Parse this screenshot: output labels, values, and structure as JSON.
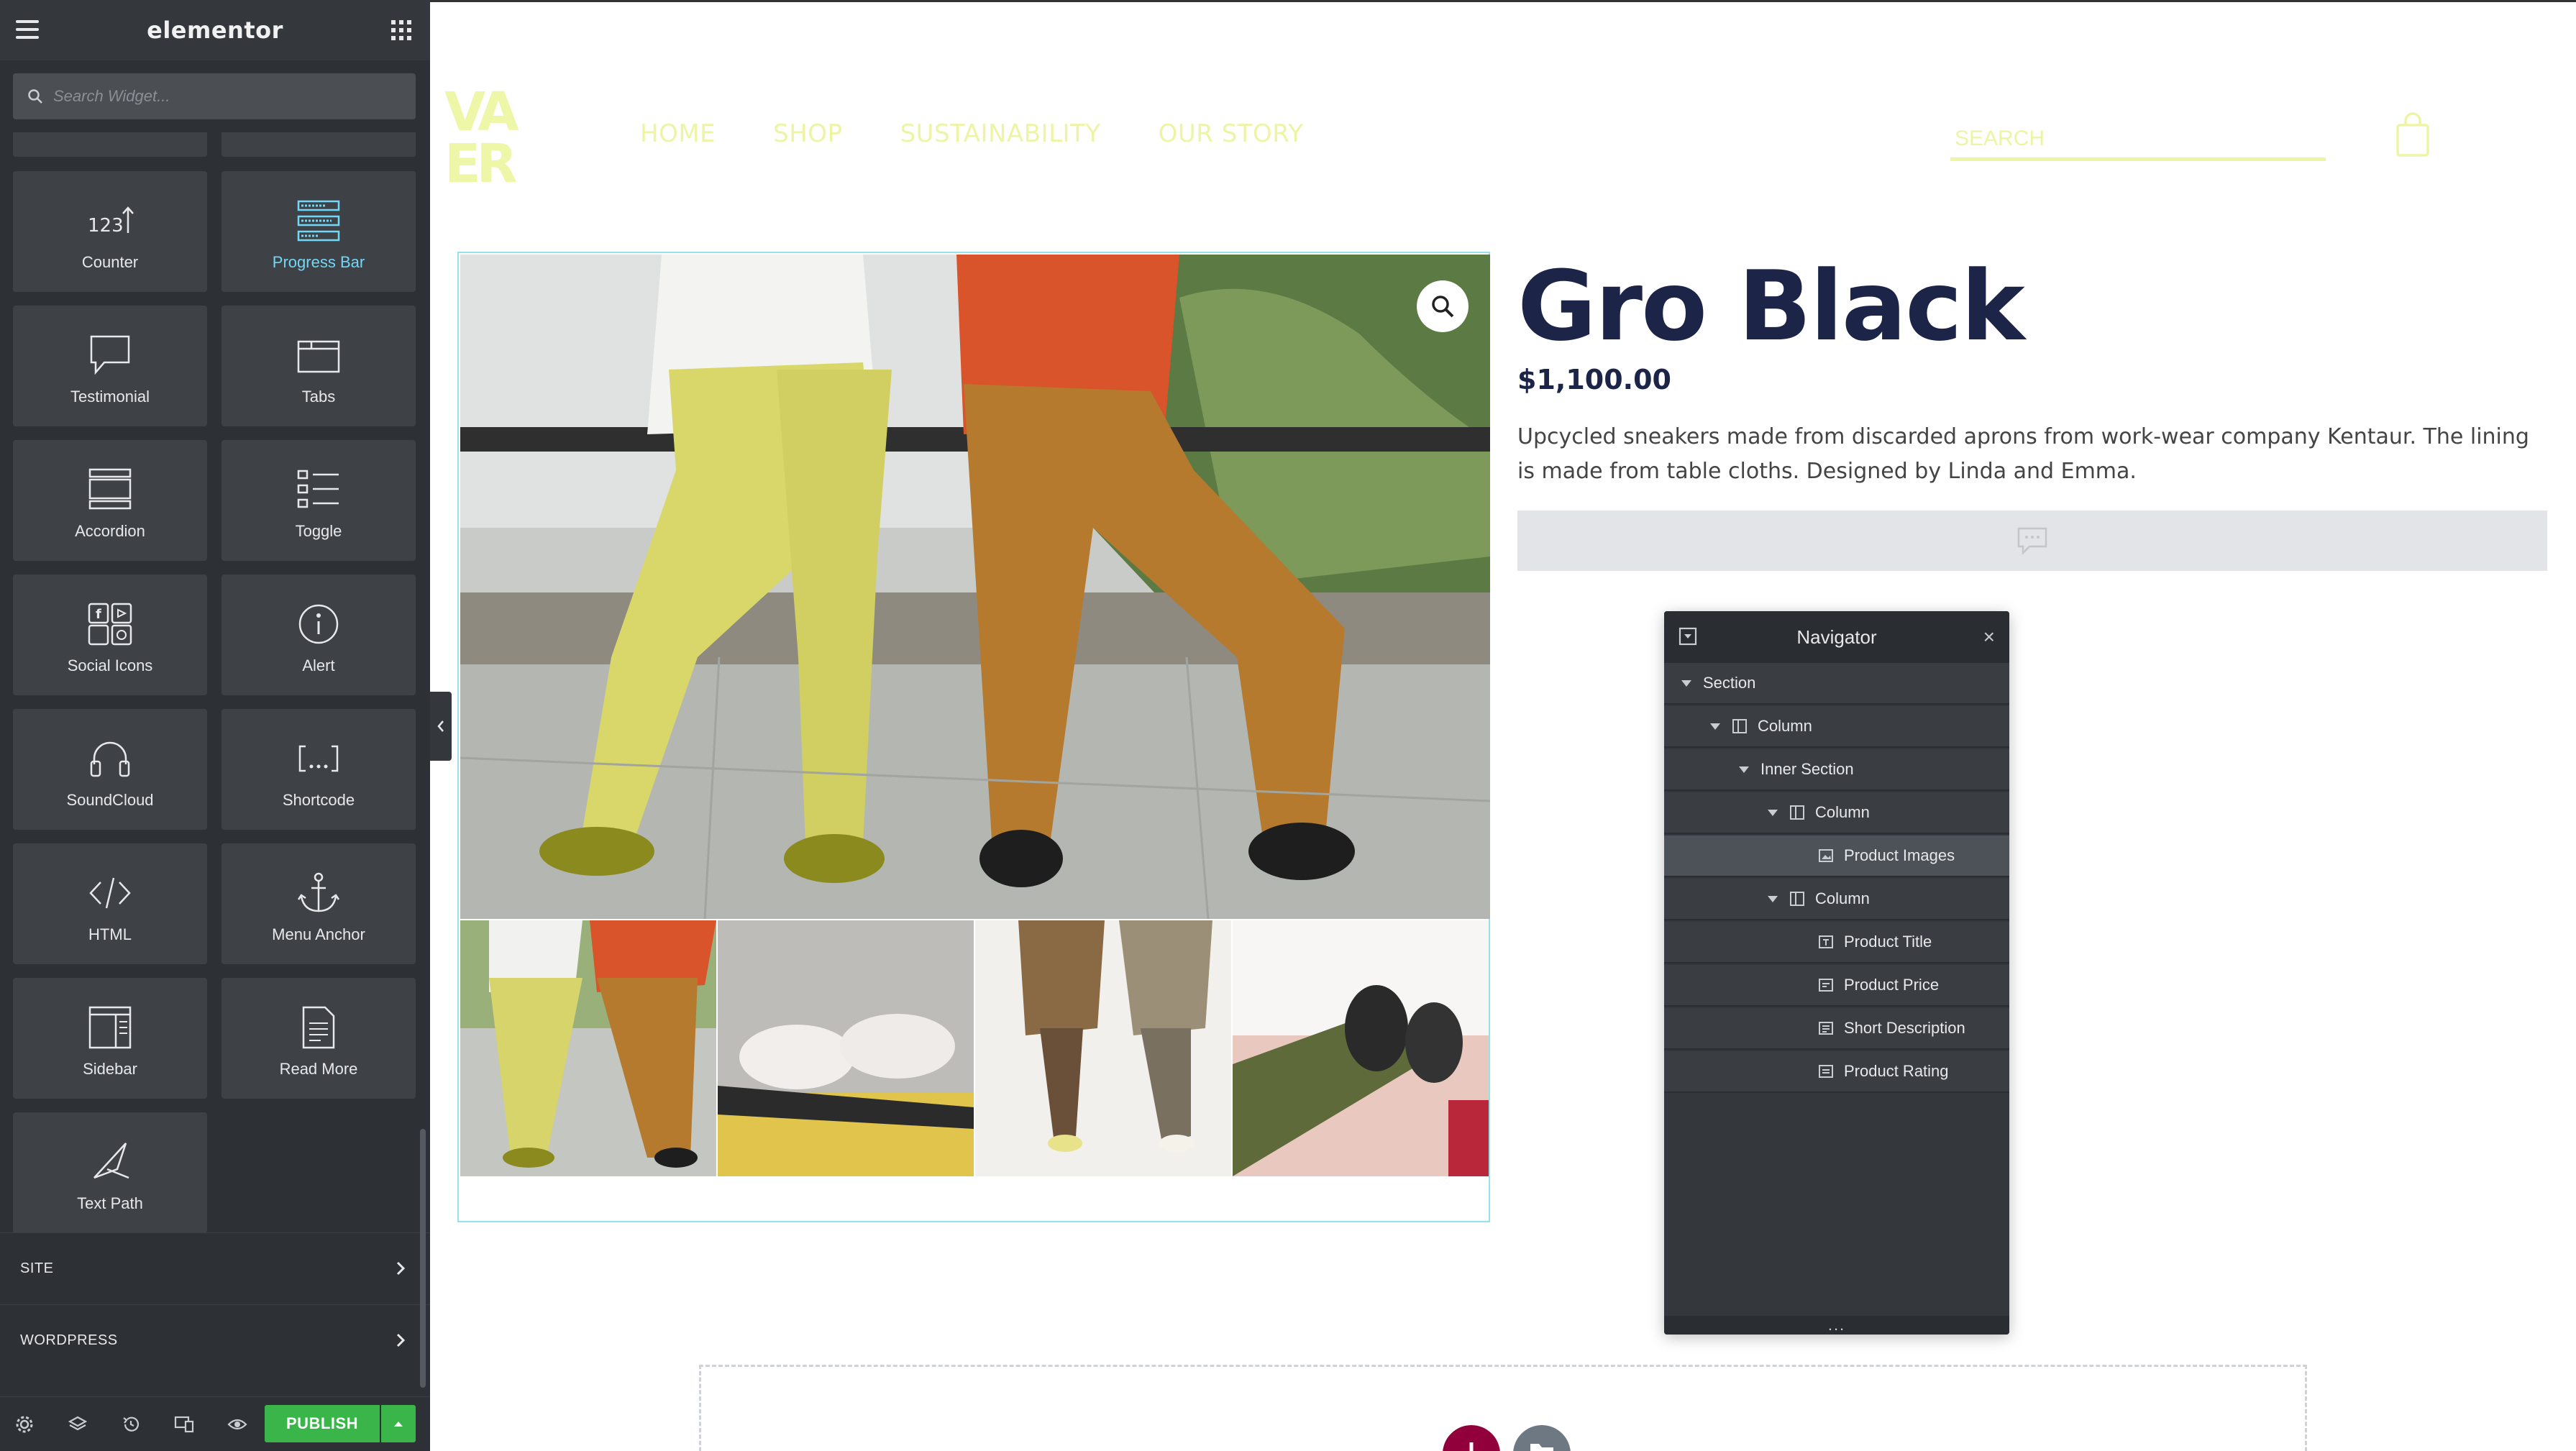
{
  "panel": {
    "brand": "elementor",
    "search_placeholder": "Search Widget...",
    "widgets": [
      {
        "label": "Counter",
        "icon": "counter-icon",
        "active": false
      },
      {
        "label": "Progress Bar",
        "icon": "progress-bar-icon",
        "active": true
      },
      {
        "label": "Testimonial",
        "icon": "testimonial-icon",
        "active": false
      },
      {
        "label": "Tabs",
        "icon": "tabs-icon",
        "active": false
      },
      {
        "label": "Accordion",
        "icon": "accordion-icon",
        "active": false
      },
      {
        "label": "Toggle",
        "icon": "toggle-icon",
        "active": false
      },
      {
        "label": "Social Icons",
        "icon": "social-icons-icon",
        "active": false
      },
      {
        "label": "Alert",
        "icon": "alert-icon",
        "active": false
      },
      {
        "label": "SoundCloud",
        "icon": "soundcloud-icon",
        "active": false
      },
      {
        "label": "Shortcode",
        "icon": "shortcode-icon",
        "active": false
      },
      {
        "label": "HTML",
        "icon": "html-icon",
        "active": false
      },
      {
        "label": "Menu Anchor",
        "icon": "anchor-icon",
        "active": false
      },
      {
        "label": "Sidebar",
        "icon": "sidebar-icon",
        "active": false
      },
      {
        "label": "Read More",
        "icon": "read-more-icon",
        "active": false
      },
      {
        "label": "Text Path",
        "icon": "text-path-icon",
        "active": false
      }
    ],
    "categories": [
      {
        "label": "SITE"
      },
      {
        "label": "WORDPRESS"
      }
    ],
    "footer": {
      "publish_label": "PUBLISH",
      "icons": [
        "settings-icon",
        "layers-icon",
        "history-icon",
        "responsive-icon",
        "preview-icon"
      ]
    }
  },
  "site": {
    "logo_text": "VAER",
    "nav": [
      "HOME",
      "SHOP",
      "SUSTAINABILITY",
      "OUR STORY"
    ],
    "search_placeholder": "SEARCH",
    "product": {
      "title": "Gro Black",
      "price": "$1,100.00",
      "description": "Upcycled sneakers made from discarded aprons from work-wear company Kentaur. The lining is made from table cloths. Designed by Linda and Emma."
    }
  },
  "navigator": {
    "title": "Navigator",
    "footer": "...",
    "items": [
      {
        "label": "Section",
        "depth": 0,
        "caret": true,
        "icon": "",
        "selected": false
      },
      {
        "label": "Column",
        "depth": 1,
        "caret": true,
        "icon": "column-icon",
        "selected": false
      },
      {
        "label": "Inner Section",
        "depth": 2,
        "caret": true,
        "icon": "",
        "selected": false
      },
      {
        "label": "Column",
        "depth": 3,
        "caret": true,
        "icon": "column-icon",
        "selected": false
      },
      {
        "label": "Product Images",
        "depth": 4,
        "caret": false,
        "icon": "image-widget-icon",
        "selected": true
      },
      {
        "label": "Column",
        "depth": 3,
        "caret": true,
        "icon": "column-icon",
        "selected": false
      },
      {
        "label": "Product Title",
        "depth": 4,
        "caret": false,
        "icon": "title-widget-icon",
        "selected": false
      },
      {
        "label": "Product Price",
        "depth": 4,
        "caret": false,
        "icon": "price-widget-icon",
        "selected": false
      },
      {
        "label": "Short Description",
        "depth": 4,
        "caret": false,
        "icon": "text-widget-icon",
        "selected": false
      },
      {
        "label": "Product Rating",
        "depth": 4,
        "caret": false,
        "icon": "rating-widget-icon",
        "selected": false
      }
    ]
  },
  "colors": {
    "panel_bg": "#2d3035",
    "tile_bg": "#3e4247",
    "active_widget": "#71d7f7",
    "publish_green": "#39b54a",
    "site_accent": "#edf5a5",
    "product_title": "#1c2448",
    "add_section": "#92003b"
  }
}
